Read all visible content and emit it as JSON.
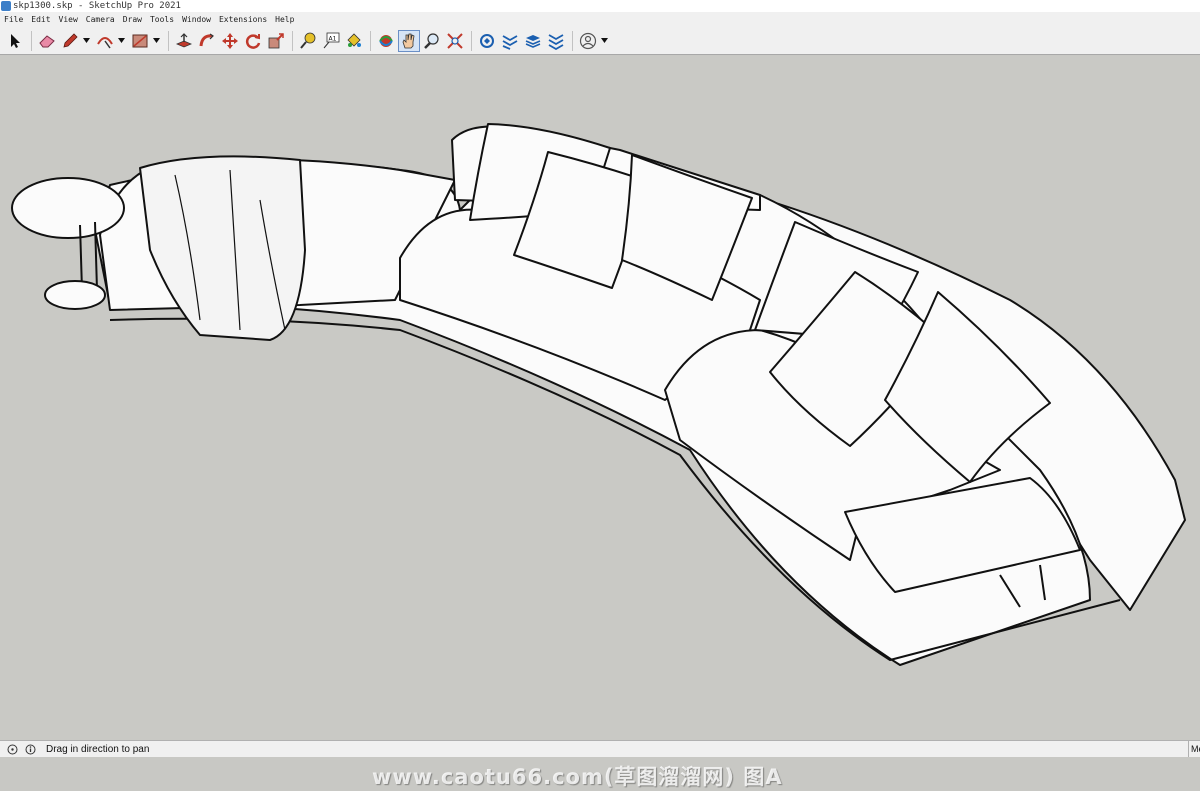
{
  "window": {
    "title": "skp1300.skp - SketchUp Pro 2021"
  },
  "menu": {
    "items": [
      "File",
      "Edit",
      "View",
      "Camera",
      "Draw",
      "Tools",
      "Window",
      "Extensions",
      "Help"
    ]
  },
  "toolbar": {
    "tools": [
      {
        "name": "select-tool",
        "icon": "arrow-cursor-icon"
      },
      {
        "name": "eraser-tool",
        "icon": "eraser-icon"
      },
      {
        "name": "line-tool",
        "icon": "pencil-icon"
      },
      {
        "name": "arc-tool",
        "icon": "arc-icon"
      },
      {
        "name": "rectangle-tool",
        "icon": "rectangle-icon"
      },
      {
        "name": "push-pull-tool",
        "icon": "push-pull-icon"
      },
      {
        "name": "follow-me-tool",
        "icon": "follow-me-icon"
      },
      {
        "name": "move-tool",
        "icon": "move-icon"
      },
      {
        "name": "rotate-tool",
        "icon": "rotate-icon"
      },
      {
        "name": "scale-tool",
        "icon": "scale-icon"
      },
      {
        "name": "tape-measure-tool",
        "icon": "tape-measure-icon"
      },
      {
        "name": "text-tool",
        "icon": "text-icon",
        "label": "A1"
      },
      {
        "name": "paint-bucket-tool",
        "icon": "paint-bucket-icon"
      },
      {
        "name": "orbit-tool",
        "icon": "orbit-icon"
      },
      {
        "name": "pan-tool",
        "icon": "hand-icon",
        "active": true
      },
      {
        "name": "zoom-tool",
        "icon": "magnifier-icon"
      },
      {
        "name": "zoom-extents-tool",
        "icon": "zoom-extents-icon"
      },
      {
        "name": "warehouse-tool",
        "icon": "warehouse-icon"
      },
      {
        "name": "extension-warehouse-tool",
        "icon": "extension-warehouse-icon"
      },
      {
        "name": "layers-tool",
        "icon": "layers-icon"
      },
      {
        "name": "extension-manager-tool",
        "icon": "extension-manager-icon"
      },
      {
        "name": "account-tool",
        "icon": "user-circle-icon"
      }
    ]
  },
  "watermark": {
    "text": "www.caotu66.com(草图溜溜网) 图A"
  },
  "status": {
    "message": "Drag in direction to pan",
    "right_label": "Me"
  },
  "colors": {
    "viewport": "#c9c9c5",
    "toolbar": "#f0f0f0",
    "active_tool": "#d6e4f6"
  }
}
